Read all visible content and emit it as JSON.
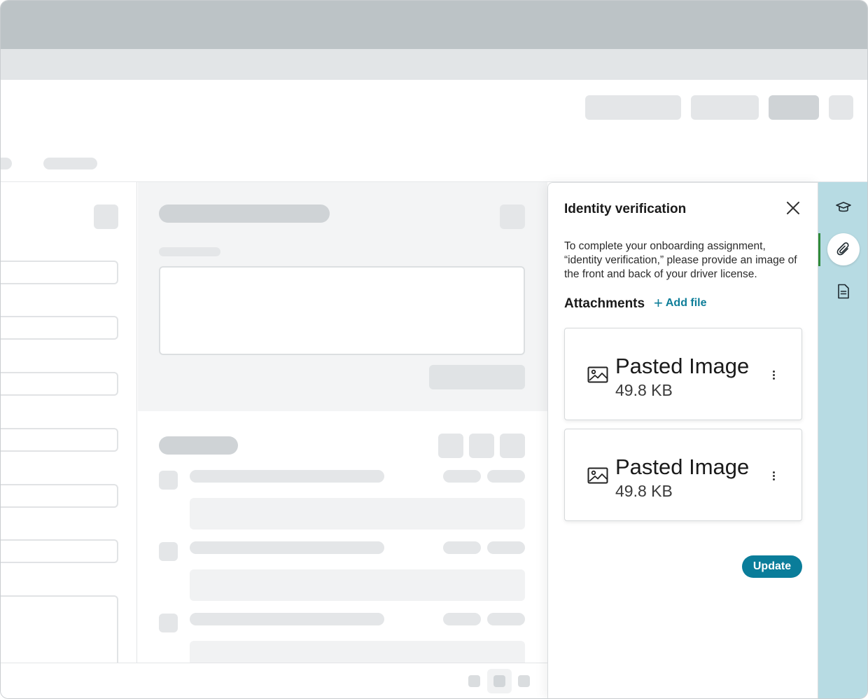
{
  "panel": {
    "title": "Identity verification",
    "description": "To complete your onboarding assignment, “identity verification,” please provide an image of the front and back of your driver license.",
    "attachments_label": "Attachments",
    "add_file_label": "Add file",
    "files": [
      {
        "name": "Pasted Image",
        "size": "49.8 KB",
        "icon": "image-icon"
      },
      {
        "name": "Pasted Image",
        "size": "49.8 KB",
        "icon": "image-icon"
      }
    ],
    "update_label": "Update"
  },
  "rail": {
    "items": [
      {
        "icon": "graduation-cap-icon",
        "active": false
      },
      {
        "icon": "paperclip-icon",
        "active": true
      },
      {
        "icon": "document-icon",
        "active": false
      }
    ]
  },
  "colors": {
    "accent": "#0a7d9a",
    "rail_background": "#b7dbe3",
    "active_indicator": "#2f8a3a",
    "titlebar": "#bcc3c6"
  }
}
